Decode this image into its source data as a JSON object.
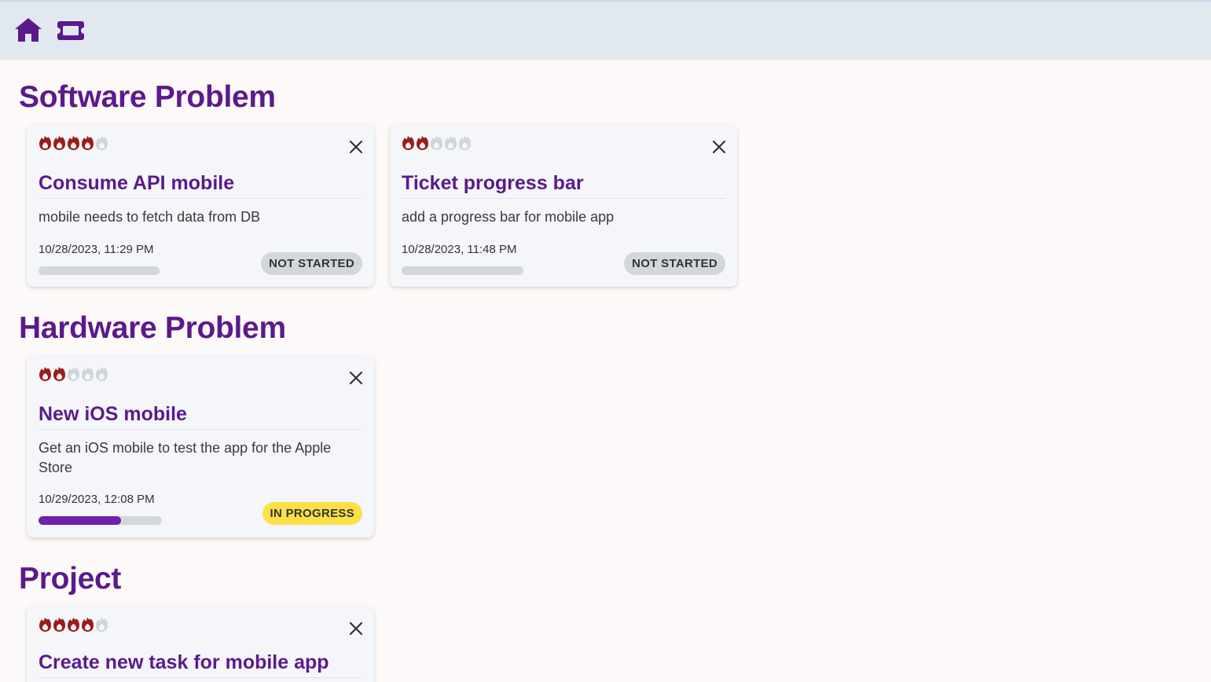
{
  "nav": {
    "home_icon": "home-icon",
    "tickets_icon": "ticket-icon",
    "icon_color": "#5b1a8c"
  },
  "colors": {
    "heading": "#5b1a8c",
    "flame_active": "#9b1c1c",
    "flame_inactive": "#d1d5db",
    "progress_fill": "#6d22a8",
    "status_not_started": "#d3d6db",
    "status_in_progress": "#fde047"
  },
  "sections": [
    {
      "title": "Software Problem",
      "tickets": [
        {
          "priority": 4,
          "priority_max": 5,
          "title": "Consume API mobile",
          "description": "mobile needs to fetch data from DB",
          "date": "10/28/2023, 11:29 PM",
          "progress": 0,
          "status": "NOT STARTED"
        },
        {
          "priority": 2,
          "priority_max": 5,
          "title": "Ticket progress bar",
          "description": "add a progress bar for mobile app",
          "date": "10/28/2023, 11:48 PM",
          "progress": 0,
          "status": "NOT STARTED"
        }
      ]
    },
    {
      "title": "Hardware Problem",
      "tickets": [
        {
          "priority": 2,
          "priority_max": 5,
          "title": "New iOS mobile",
          "description": "Get an iOS mobile to test the app for the Apple Store",
          "date": "10/29/2023, 12:08 PM",
          "progress": 0.67,
          "status": "IN PROGRESS"
        }
      ]
    },
    {
      "title": "Project",
      "tickets": [
        {
          "priority": 4,
          "priority_max": 5,
          "title": "Create new task for mobile app"
        }
      ]
    }
  ]
}
